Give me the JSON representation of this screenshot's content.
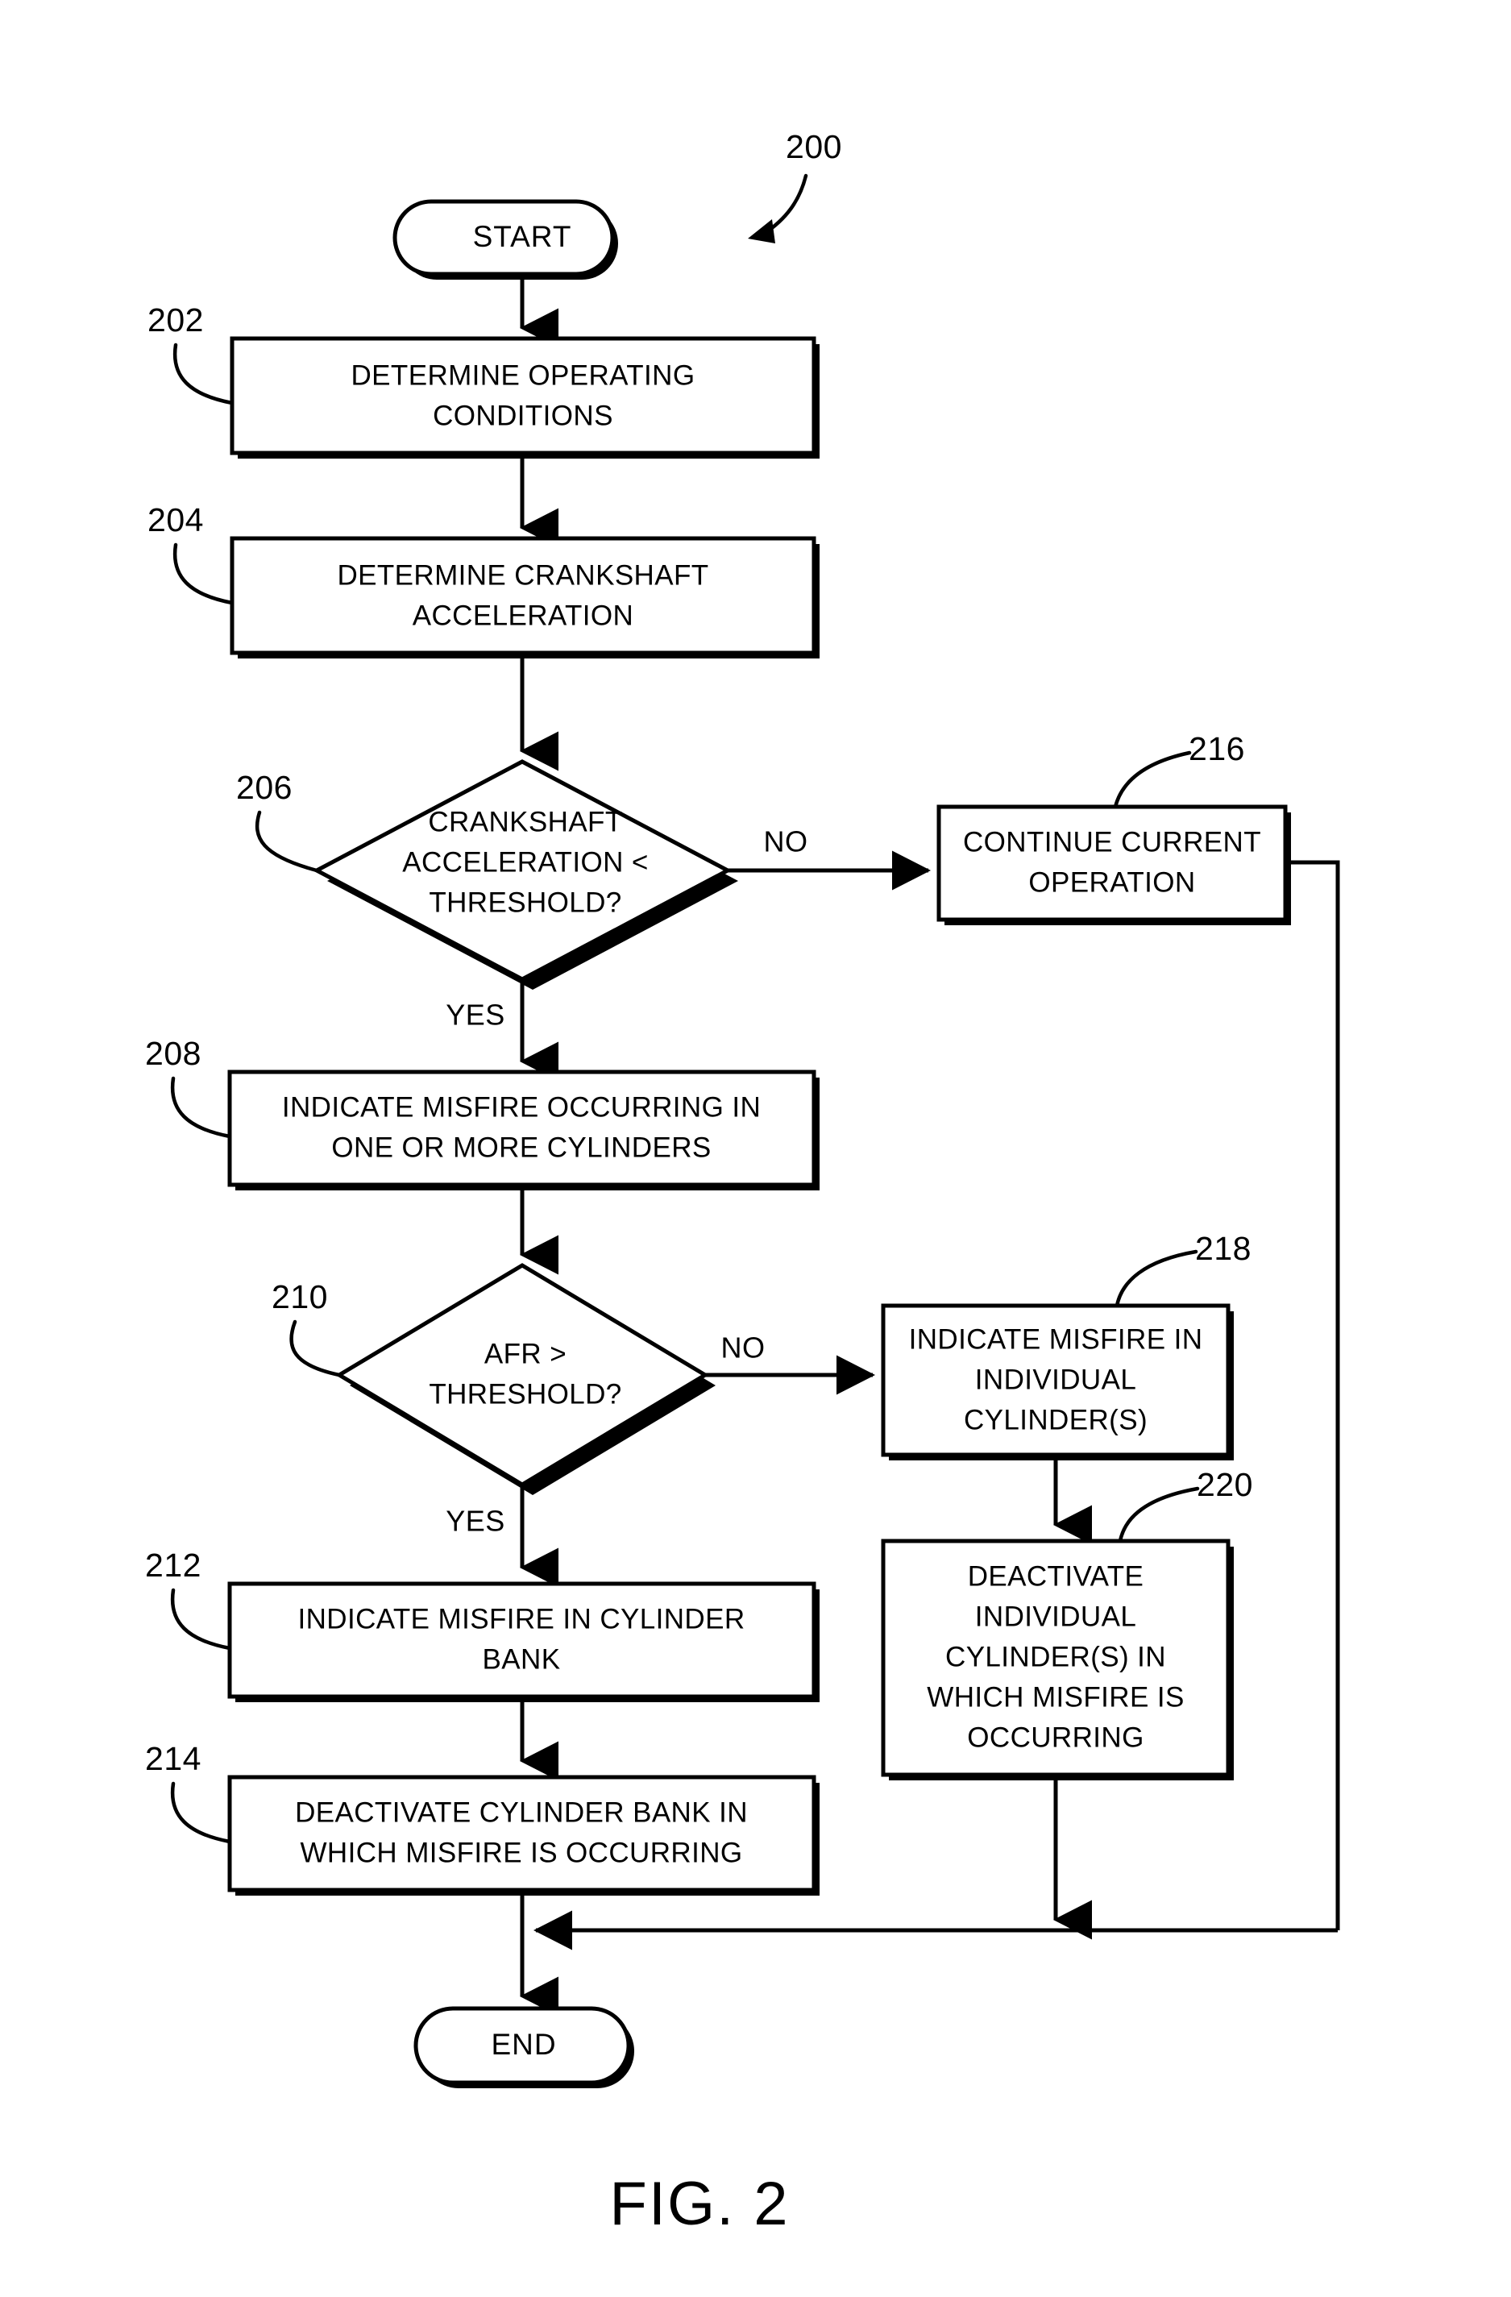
{
  "figure": {
    "caption": "FIG. 2",
    "diagram_ref": "200"
  },
  "terminals": {
    "start": "START",
    "end": "END"
  },
  "branch_labels": {
    "no_206": "NO",
    "yes_206": "YES",
    "no_210": "NO",
    "yes_210": "YES"
  },
  "nodes": [
    {
      "ref": "202",
      "type": "process",
      "lines": [
        "DETERMINE OPERATING",
        "CONDITIONS"
      ]
    },
    {
      "ref": "204",
      "type": "process",
      "lines": [
        "DETERMINE CRANKSHAFT",
        "ACCELERATION"
      ]
    },
    {
      "ref": "206",
      "type": "decision",
      "lines": [
        "CRANKSHAFT",
        "ACCELERATION <",
        "THRESHOLD?"
      ]
    },
    {
      "ref": "208",
      "type": "process",
      "lines": [
        "INDICATE MISFIRE OCCURRING IN",
        "ONE OR MORE CYLINDERS"
      ]
    },
    {
      "ref": "210",
      "type": "decision",
      "lines": [
        "AFR >",
        "THRESHOLD?"
      ]
    },
    {
      "ref": "212",
      "type": "process",
      "lines": [
        "INDICATE MISFIRE IN CYLINDER",
        "BANK"
      ]
    },
    {
      "ref": "214",
      "type": "process",
      "lines": [
        "DEACTIVATE CYLINDER BANK IN",
        "WHICH MISFIRE IS OCCURRING"
      ]
    },
    {
      "ref": "216",
      "type": "process",
      "lines": [
        "CONTINUE CURRENT",
        "OPERATION"
      ]
    },
    {
      "ref": "218",
      "type": "process",
      "lines": [
        "INDICATE MISFIRE IN",
        "INDIVIDUAL",
        "CYLINDER(S)"
      ]
    },
    {
      "ref": "220",
      "type": "process",
      "lines": [
        "DEACTIVATE",
        "INDIVIDUAL",
        "CYLINDER(S) IN",
        "WHICH MISFIRE IS",
        "OCCURRING"
      ]
    }
  ],
  "colors": {
    "ink": "#000000",
    "paper": "#ffffff"
  }
}
